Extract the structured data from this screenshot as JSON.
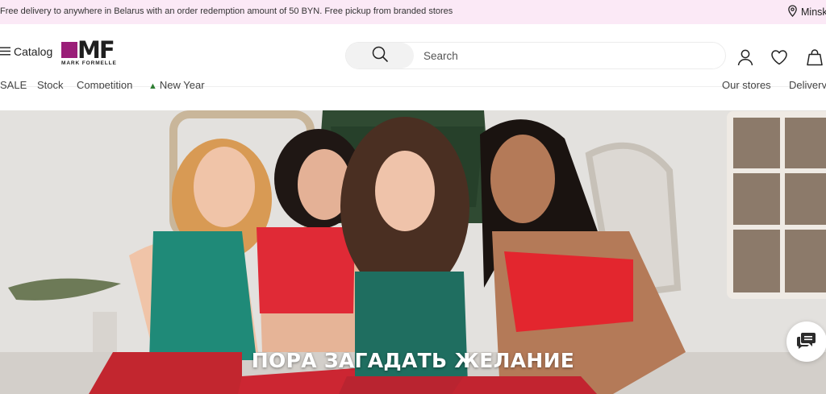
{
  "promo": {
    "text": "Free delivery to anywhere in Belarus with an order redemption amount of 50 BYN. Free pickup from branded stores",
    "city": "Minsk"
  },
  "header": {
    "catalog_label": "Catalog",
    "logo_text": "MF",
    "logo_subtext": "MARK FORMELLE",
    "search_placeholder": "Search"
  },
  "nav": {
    "left_items": [
      "SALE",
      "Stock",
      "Competition",
      "New Year"
    ],
    "right_items": [
      "Our stores",
      "Delivery"
    ]
  },
  "hero": {
    "caption": "ПОРА ЗАГАДАТЬ ЖЕЛАНИЕ"
  },
  "colors": {
    "promo_bg": "#fbe9f6",
    "brand": "#9a1e78"
  }
}
